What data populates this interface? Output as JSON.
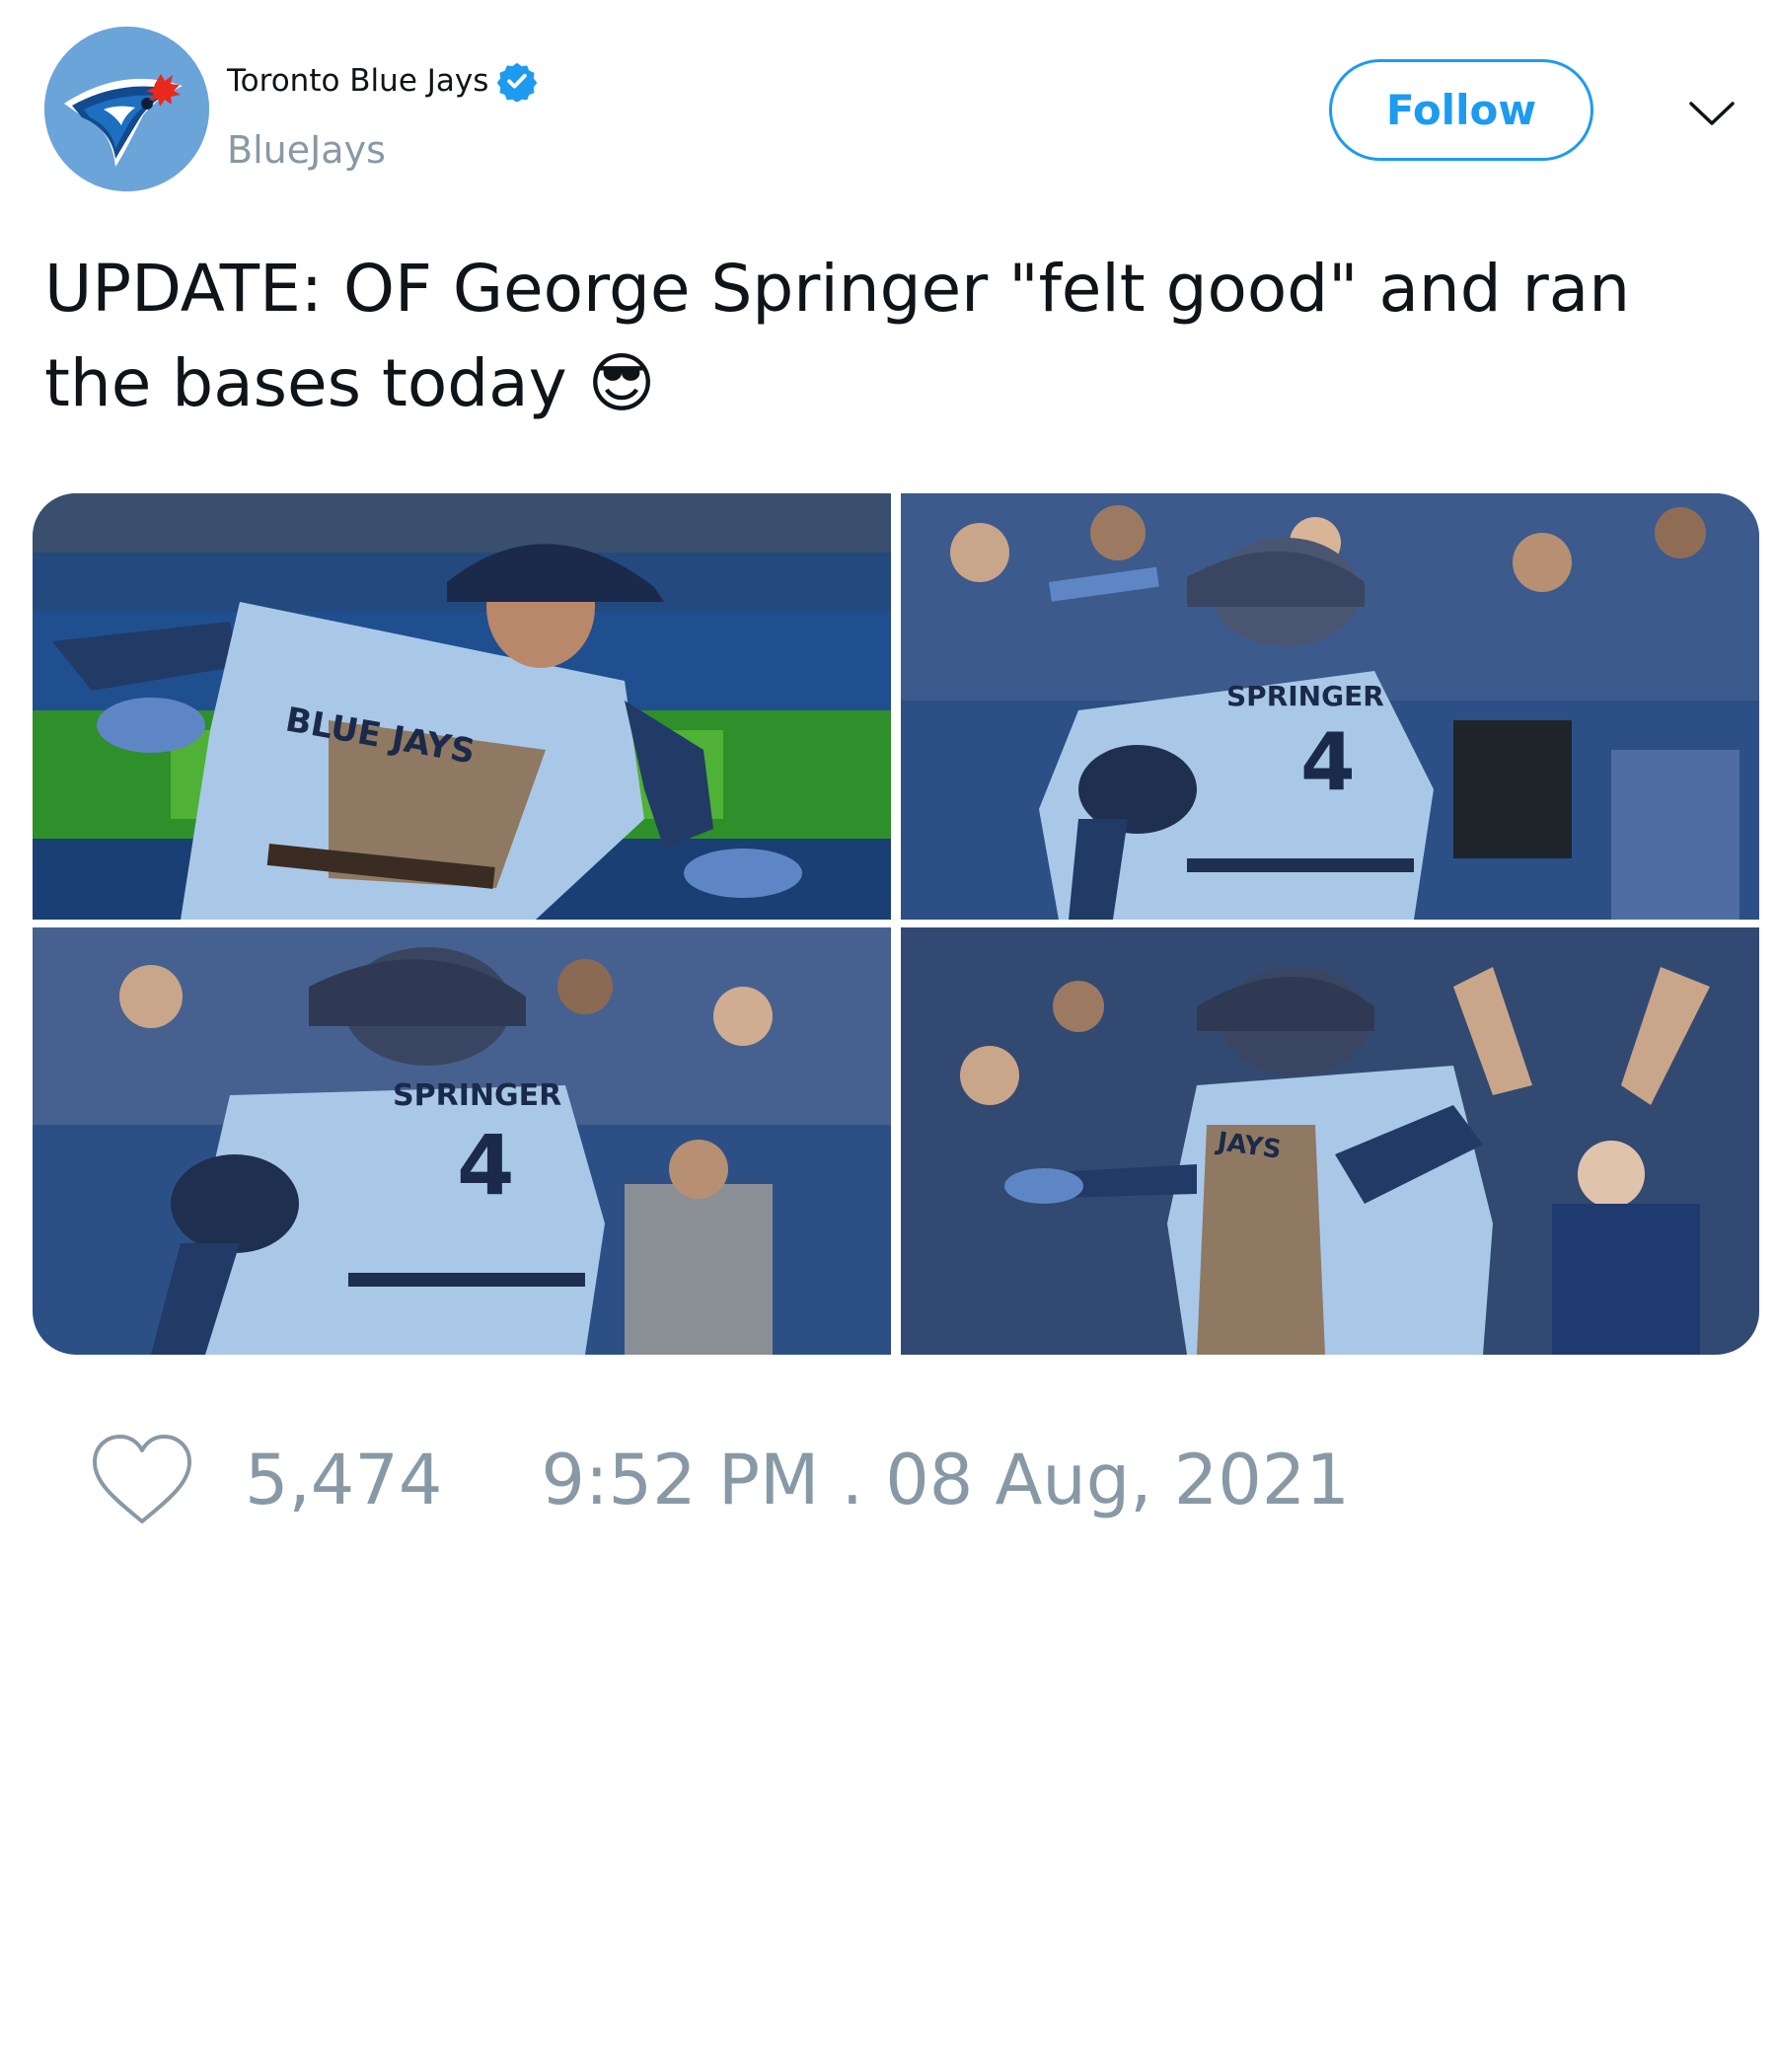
{
  "account": {
    "display_name": "Toronto Blue Jays",
    "handle": "BlueJays",
    "verified": true,
    "avatar_icon": "blue-jay-logo-icon"
  },
  "follow_button": {
    "label": "Follow"
  },
  "menu": {
    "icon": "chevron-down-icon"
  },
  "tweet": {
    "text": "UPDATE: OF George Springer \"felt good\" and ran the bases today 😎"
  },
  "media": {
    "photos": [
      {
        "jersey_text": "BLUE JAYS"
      },
      {
        "jersey_name": "SPRINGER",
        "jersey_number": "4"
      },
      {
        "jersey_name": "SPRINGER",
        "jersey_number": "4"
      },
      {
        "jersey_text": "JAYS"
      }
    ]
  },
  "stats": {
    "like_icon": "heart-icon",
    "likes": "5,474",
    "timestamp": "9:52 PM . 08 Aug, 2021"
  },
  "colors": {
    "accent": "#1d9bf0",
    "muted": "#8899a6",
    "jersey": "#a9c8e8",
    "dirt": "#8b6b4a",
    "crowd": "#2c4f86"
  }
}
